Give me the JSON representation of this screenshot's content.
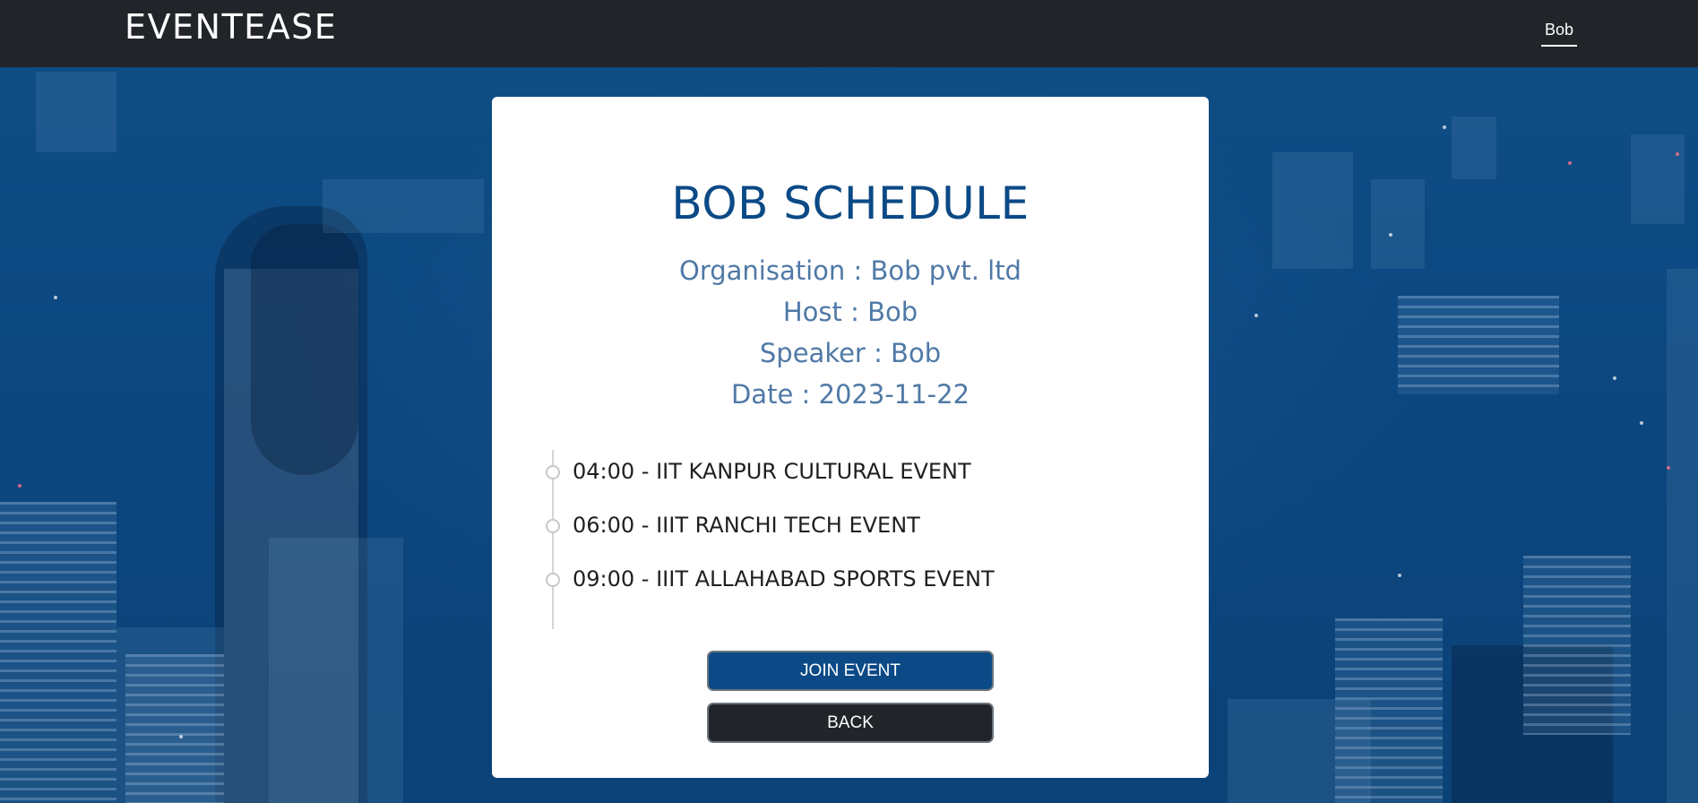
{
  "navbar": {
    "brand": "EVENTEASE",
    "user": "Bob"
  },
  "schedule": {
    "title": "BOB SCHEDULE",
    "organisation": "Organisation : Bob pvt. ltd",
    "host": "Host : Bob",
    "speaker": "Speaker : Bob",
    "date": "Date : 2023-11-22",
    "events": [
      {
        "text": "04:00 - IIT KANPUR CULTURAL EVENT"
      },
      {
        "text": "06:00 - IIIT RANCHI TECH EVENT"
      },
      {
        "text": "09:00 - IIIT ALLAHABAD SPORTS EVENT"
      }
    ]
  },
  "buttons": {
    "join": "JOIN EVENT",
    "back": "BACK"
  },
  "colors": {
    "navbar": "#212529",
    "accent": "#0b4a86",
    "meta_text": "#4f79a6",
    "background": "#0d4a82"
  }
}
